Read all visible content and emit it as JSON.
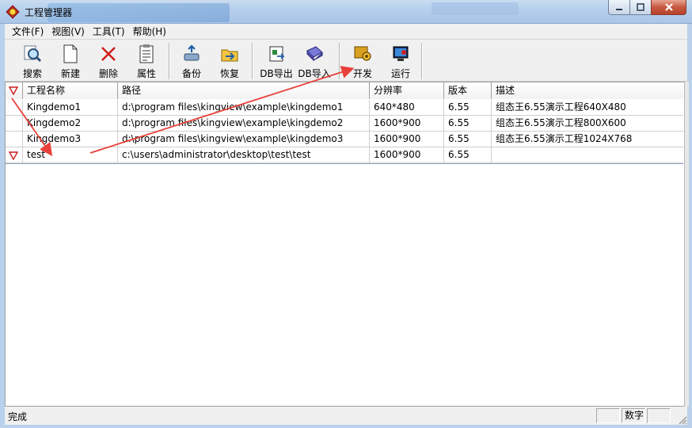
{
  "window": {
    "title": "工程管理器"
  },
  "menu": [
    "文件(F)",
    "视图(V)",
    "工具(T)",
    "帮助(H)"
  ],
  "toolbar": {
    "search": "搜索",
    "new": "新建",
    "delete": "删除",
    "properties": "属性",
    "backup": "备份",
    "restore": "恢复",
    "db_export": "DB导出",
    "db_import": "DB导入",
    "develop": "开发",
    "run": "运行"
  },
  "table": {
    "columns": [
      "工程名称",
      "路径",
      "分辨率",
      "版本",
      "描述"
    ],
    "rows": [
      {
        "name": "Kingdemo1",
        "path": "d:\\program files\\kingview\\example\\kingdemo1",
        "resolution": "640*480",
        "version": "6.55",
        "desc": "组态王6.55演示工程640X480",
        "flagged": false
      },
      {
        "name": "Kingdemo2",
        "path": "d:\\program files\\kingview\\example\\kingdemo2",
        "resolution": "1600*900",
        "version": "6.55",
        "desc": "组态王6.55演示工程800X600",
        "flagged": false
      },
      {
        "name": "Kingdemo3",
        "path": "d:\\program files\\kingview\\example\\kingdemo3",
        "resolution": "1600*900",
        "version": "6.55",
        "desc": "组态王6.55演示工程1024X768",
        "flagged": false
      },
      {
        "name": "test",
        "path": "c:\\users\\administrator\\desktop\\test\\test",
        "resolution": "1600*900",
        "version": "6.55",
        "desc": "",
        "flagged": true
      }
    ]
  },
  "status": {
    "text": "完成",
    "numlock": "数字"
  },
  "colors": {
    "annotation_arrow": "#e8403a",
    "flag": "#cc1f1f",
    "title_bar": "#b7d0ec"
  }
}
